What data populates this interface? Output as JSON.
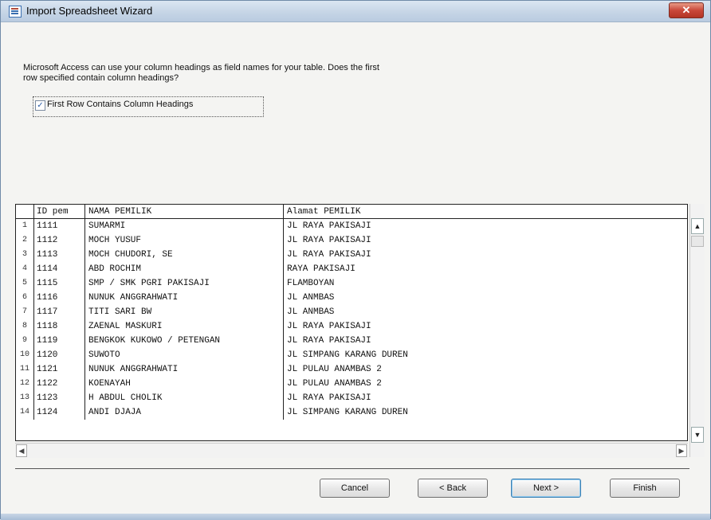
{
  "window": {
    "title": "Import Spreadsheet Wizard",
    "close_label": "✕"
  },
  "prompt": {
    "line1": "Microsoft Access can use your column headings as field names for your table. Does the first",
    "line2": "row specified contain column headings?"
  },
  "checkbox": {
    "label": "First Row Contains Column Headings",
    "checked": true,
    "mark": "✓"
  },
  "grid": {
    "columns": [
      "ID pem",
      "NAMA PEMILIK",
      "Alamat PEMILIK"
    ],
    "rows": [
      {
        "n": "1",
        "id": "1111",
        "name": "SUMARMI",
        "addr": "JL RAYA PAKISAJI"
      },
      {
        "n": "2",
        "id": "1112",
        "name": "MOCH YUSUF",
        "addr": "JL RAYA PAKISAJI"
      },
      {
        "n": "3",
        "id": "1113",
        "name": "MOCH CHUDORI, SE",
        "addr": "JL RAYA PAKISAJI"
      },
      {
        "n": "4",
        "id": "1114",
        "name": "ABD ROCHIM",
        "addr": "RAYA PAKISAJI"
      },
      {
        "n": "5",
        "id": "1115",
        "name": "SMP / SMK PGRI PAKISAJI",
        "addr": "FLAMBOYAN"
      },
      {
        "n": "6",
        "id": "1116",
        "name": "NUNUK ANGGRAHWATI",
        "addr": "JL ANMBAS"
      },
      {
        "n": "7",
        "id": "1117",
        "name": "TITI SARI BW",
        "addr": "JL ANMBAS"
      },
      {
        "n": "8",
        "id": "1118",
        "name": "ZAENAL MASKURI",
        "addr": "JL RAYA PAKISAJI"
      },
      {
        "n": "9",
        "id": "1119",
        "name": "BENGKOK KUKOWO / PETENGAN",
        "addr": "JL RAYA PAKISAJI"
      },
      {
        "n": "10",
        "id": "1120",
        "name": "SUWOTO",
        "addr": "JL SIMPANG KARANG DUREN"
      },
      {
        "n": "11",
        "id": "1121",
        "name": "NUNUK ANGGRAHWATI",
        "addr": "JL PULAU ANAMBAS 2"
      },
      {
        "n": "12",
        "id": "1122",
        "name": "KOENAYAH",
        "addr": "JL PULAU ANAMBAS 2"
      },
      {
        "n": "13",
        "id": "1123",
        "name": "H ABDUL CHOLIK",
        "addr": "JL RAYA PAKISAJI"
      },
      {
        "n": "14",
        "id": "1124",
        "name": "ANDI DJAJA",
        "addr": "JL SIMPANG KARANG DUREN"
      }
    ]
  },
  "scroll": {
    "up": "▲",
    "down": "▼",
    "left": "◀",
    "right": "▶"
  },
  "buttons": {
    "cancel": "Cancel",
    "back": "< Back",
    "next": "Next >",
    "finish": "Finish"
  }
}
